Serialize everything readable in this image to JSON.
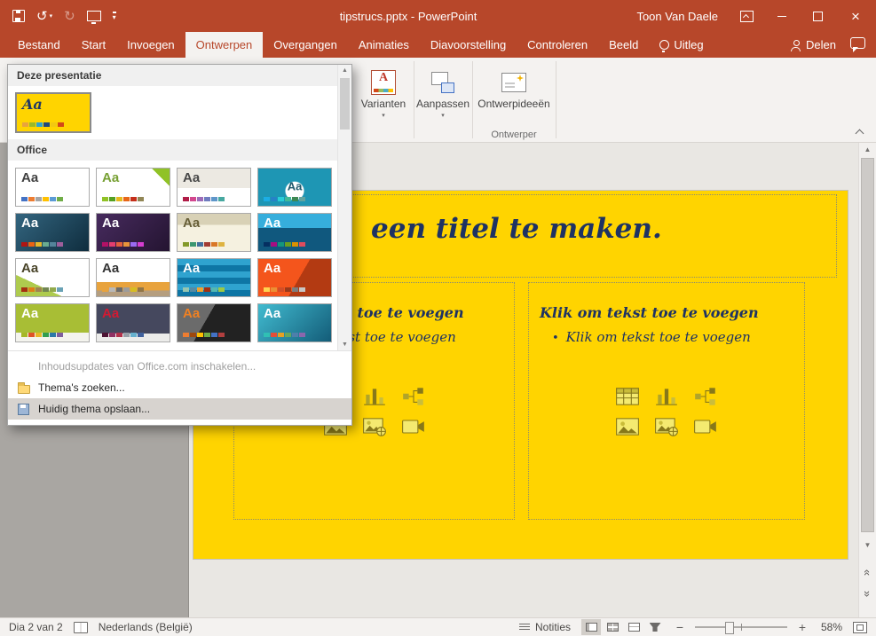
{
  "titlebar": {
    "title": "tipstrucs.pptx  -  PowerPoint",
    "user": "Toon Van Daele"
  },
  "tabs": [
    {
      "label": "Bestand"
    },
    {
      "label": "Start"
    },
    {
      "label": "Invoegen"
    },
    {
      "label": "Ontwerpen",
      "active": true
    },
    {
      "label": "Overgangen"
    },
    {
      "label": "Animaties"
    },
    {
      "label": "Diavoorstelling"
    },
    {
      "label": "Controleren"
    },
    {
      "label": "Beeld"
    },
    {
      "label": "Uitleg",
      "bulb": true
    }
  ],
  "share": {
    "label": "Delen"
  },
  "ribbon": {
    "varianten": "Varianten",
    "aanpassen": "Aanpassen",
    "ontwerpideeen": "Ontwerpideeën",
    "group": "Ontwerper"
  },
  "themes_panel": {
    "current_header": "Deze presentatie",
    "office_header": "Office",
    "aa_label": "Aa",
    "current": {
      "bg": "#FFD400",
      "fg": "#203864",
      "script": true,
      "swatches": [
        "#E8A33D",
        "#9BB928",
        "#2FA3CF",
        "#1F497D",
        "#F2C811",
        "#D34817"
      ]
    },
    "office": [
      {
        "bg": "#FFFFFF",
        "fg": "#404040",
        "swatches": [
          "#4472C4",
          "#ED7D31",
          "#A5A5A5",
          "#FFC000",
          "#5B9BD5",
          "#70AD47"
        ]
      },
      {
        "bg": "linear-gradient(225deg,#90C226 16%,#FFFFFF 16%)",
        "fg": "#77A033",
        "swatches": [
          "#90C226",
          "#54A021",
          "#E6B91E",
          "#E76618",
          "#C42F1A",
          "#918655"
        ]
      },
      {
        "bg": "linear-gradient(180deg,#ECE9E2 52%,#FFFFFF 52%)",
        "fg": "#484848",
        "swatches": [
          "#B01C47",
          "#D2478E",
          "#9C6CB8",
          "#6F7CBF",
          "#5E96C9",
          "#47A8A0"
        ]
      },
      {
        "bg": "radial-gradient(circle at 50% 60%,#FFFFFF 10px,#1E96B4 11px)",
        "fg": "#20586C",
        "center": true,
        "swatches": [
          "#1CADE4",
          "#2683C6",
          "#27CED7",
          "#42BA97",
          "#3E8853",
          "#62A39F"
        ]
      },
      {
        "bg": "linear-gradient(135deg,#33657F,#0F2D3E)",
        "fg": "#FFFFFF",
        "swatches": [
          "#B01513",
          "#EA6312",
          "#E6B729",
          "#6AAC90",
          "#54849A",
          "#9E5E9B"
        ]
      },
      {
        "bg": "linear-gradient(135deg,#472B5E,#241431)",
        "fg": "#FFFFFF",
        "swatches": [
          "#B31166",
          "#E33D6F",
          "#E45F3C",
          "#E9943A",
          "#9B6BF2",
          "#D53DD0"
        ]
      },
      {
        "bg": "linear-gradient(180deg,#D8D1B6 30%,#F5F1E0 30%)",
        "fg": "#675F38",
        "swatches": [
          "#83992A",
          "#3C9770",
          "#44709D",
          "#A23C33",
          "#D97828",
          "#DEB340"
        ]
      },
      {
        "bg": "linear-gradient(180deg,#36AEDC 38%,#10587E 38%)",
        "fg": "#FFFFFF",
        "swatches": [
          "#052F61",
          "#A50E82",
          "#14967C",
          "#6A9E1F",
          "#D99100",
          "#DE4C5E"
        ]
      },
      {
        "bg": "linear-gradient(205deg,#FFFFFF 70%,#AECB4E 70%)",
        "fg": "#494429",
        "swatches": [
          "#A53010",
          "#DE7E18",
          "#9F8351",
          "#728653",
          "#92AA4C",
          "#6AA2B5"
        ]
      },
      {
        "bg": "linear-gradient(180deg,#FFFFFF 62%,#E8A33D 62% 84%,#B59E7F 84%)",
        "fg": "#333333",
        "swatches": [
          "#E8A33D",
          "#B8B8B8",
          "#6B6B6B",
          "#9C9C9C",
          "#D6BD22",
          "#917546"
        ]
      },
      {
        "bg": "repeating-linear-gradient(180deg,#2FA3CF 0 7px,#0E76A5 7px 14px)",
        "fg": "#FFFFFF",
        "swatches": [
          "#95C5B0",
          "#568BA4",
          "#F0A22E",
          "#A5300F",
          "#54B8B1",
          "#9CC944"
        ]
      },
      {
        "bg": "linear-gradient(120deg,#F4551C 55%,#B33A12 55%)",
        "fg": "#FFFFFF",
        "swatches": [
          "#FFD350",
          "#EB8F35",
          "#D14E28",
          "#9B3B1B",
          "#7D7D7D",
          "#C8C6C4"
        ]
      },
      {
        "bg": "linear-gradient(180deg,#A8BE35 76%,#F4F4EE 76%)",
        "fg": "#FFFFFF",
        "swatches": [
          "#A6B727",
          "#DF5327",
          "#E8B727",
          "#329E4E",
          "#2D79A8",
          "#7F5F9E"
        ]
      },
      {
        "bg": "linear-gradient(180deg,#45485E 78%,#ECECEA 78%)",
        "fg": "#D41A32",
        "swatches": [
          "#4D1434",
          "#903163",
          "#B2324B",
          "#969FA7",
          "#66B1CE",
          "#40619D"
        ]
      },
      {
        "bg": "linear-gradient(120deg,#6B6B6B 40%,#222222 40%)",
        "fg": "#F08122",
        "swatches": [
          "#ED7D31",
          "#9E480E",
          "#FFC000",
          "#70AD47",
          "#4472C4",
          "#B13F3F"
        ]
      },
      {
        "bg": "linear-gradient(135deg,#41BBD0,#135C78)",
        "fg": "#FFFFFF",
        "swatches": [
          "#30C0B4",
          "#E34E38",
          "#E5A023",
          "#64A65F",
          "#4E7FAB",
          "#8A67AD"
        ]
      }
    ],
    "menu": [
      {
        "name": "menu-item-content-updates",
        "label": "Inhoudsupdates van Office.com inschakelen...",
        "enabled": false
      },
      {
        "name": "menu-item-browse-themes",
        "label": "Thema's zoeken...",
        "icon": "browse-themes-icon",
        "enabled": true
      },
      {
        "name": "menu-item-save-current-theme",
        "label": "Huidig thema opslaan...",
        "icon": "save-theme-icon",
        "enabled": true,
        "highlighted": true
      }
    ]
  },
  "slide": {
    "title_text": "een titel te maken.",
    "body_heading": "Klik om tekst toe te voegen",
    "body_bullet": "Klik om tekst toe te voegen",
    "bullet_char": "•",
    "bg_color": "#FFD400",
    "text_color": "#1E3263",
    "icons": [
      "table-icon",
      "chart-icon",
      "smartart-icon",
      "picture-icon",
      "online-picture-icon",
      "video-icon"
    ]
  },
  "statusbar": {
    "slide_indicator": "Dia 2 van 2",
    "language": "Nederlands (België)",
    "notes": "Notities",
    "zoom": "58%",
    "view_buttons": [
      "normal-view-button",
      "slide-sorter-button",
      "reading-view-button",
      "slideshow-button"
    ]
  },
  "colors": {
    "accent": "#B7472A",
    "ribbon_bg": "#F4F2F0"
  }
}
